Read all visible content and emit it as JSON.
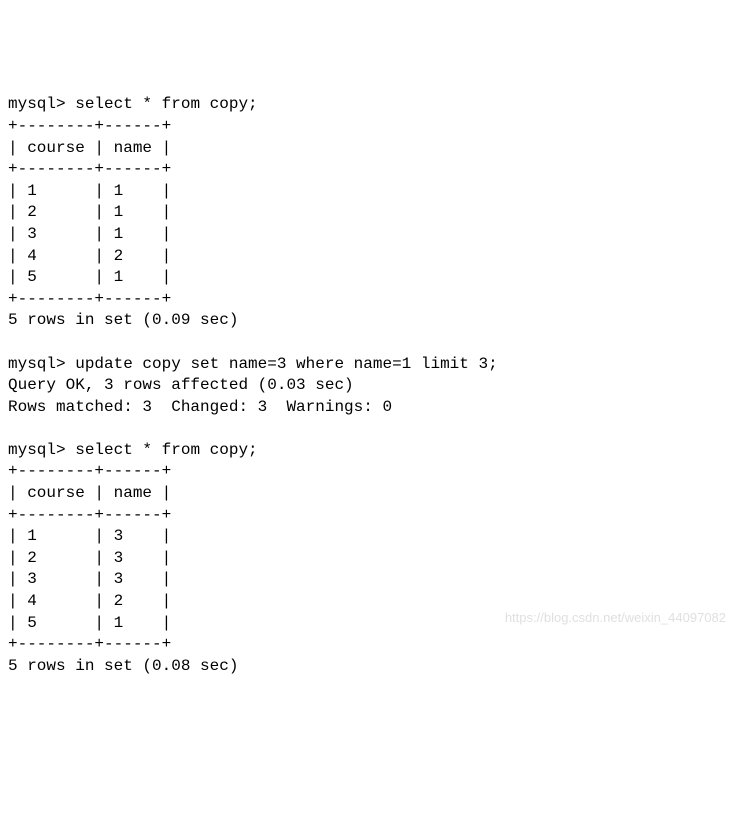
{
  "session": {
    "prompt": "mysql>",
    "queries": [
      {
        "command": "select * from copy;",
        "table": {
          "border_top": "+--------+------+",
          "header_row": "| course | name |",
          "border_mid": "+--------+------+",
          "columns": [
            "course",
            "name"
          ],
          "rows": [
            {
              "course": "1",
              "name": "1"
            },
            {
              "course": "2",
              "name": "1"
            },
            {
              "course": "3",
              "name": "1"
            },
            {
              "course": "4",
              "name": "2"
            },
            {
              "course": "5",
              "name": "1"
            }
          ],
          "row_lines": [
            "| 1      | 1    |",
            "| 2      | 1    |",
            "| 3      | 1    |",
            "| 4      | 2    |",
            "| 5      | 1    |"
          ],
          "border_bot": "+--------+------+"
        },
        "footer": "5 rows in set (0.09 sec)"
      },
      {
        "command": "update copy set name=3 where name=1 limit 3;",
        "result_lines": [
          "Query OK, 3 rows affected (0.03 sec)",
          "Rows matched: 3  Changed: 3  Warnings: 0"
        ]
      },
      {
        "command": "select * from copy;",
        "table": {
          "border_top": "+--------+------+",
          "header_row": "| course | name |",
          "border_mid": "+--------+------+",
          "columns": [
            "course",
            "name"
          ],
          "rows": [
            {
              "course": "1",
              "name": "3"
            },
            {
              "course": "2",
              "name": "3"
            },
            {
              "course": "3",
              "name": "3"
            },
            {
              "course": "4",
              "name": "2"
            },
            {
              "course": "5",
              "name": "1"
            }
          ],
          "row_lines": [
            "| 1      | 3    |",
            "| 2      | 3    |",
            "| 3      | 3    |",
            "| 4      | 2    |",
            "| 5      | 1    |"
          ],
          "border_bot": "+--------+------+"
        },
        "footer": "5 rows in set (0.08 sec)"
      }
    ]
  },
  "watermark": "https://blog.csdn.net/weixin_44097082"
}
